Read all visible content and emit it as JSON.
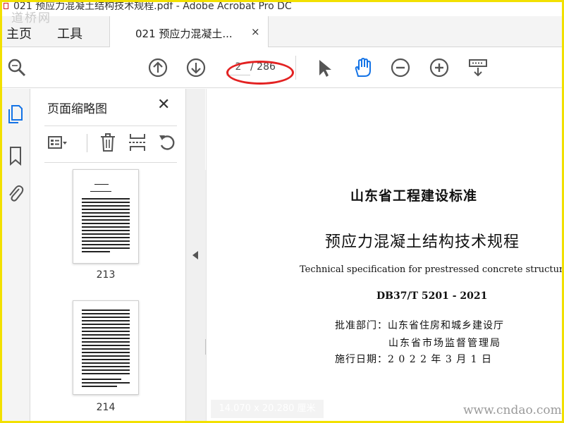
{
  "window": {
    "title": "021 预应力混凝土结构技术规程.pdf - Adobe Acrobat Pro DC",
    "watermark_top": "道桥网",
    "watermark_bottom": "www.cndao.com"
  },
  "nav": {
    "home": "主页",
    "tools": "工具"
  },
  "tab": {
    "label": "021 预应力混凝土...",
    "close": "×"
  },
  "toolbar": {
    "current_page": "2",
    "total_pages": "/ 286",
    "icons": [
      "zoom-search-icon",
      "previous-page-icon",
      "next-page-icon",
      "select-arrow-icon",
      "hand-tool-icon",
      "zoom-out-icon",
      "zoom-in-icon",
      "keyboard-icon"
    ]
  },
  "sidebar": {
    "icons": [
      "page-thumbnails-icon",
      "bookmark-icon",
      "attachment-icon"
    ]
  },
  "panel": {
    "title": "页面缩略图",
    "close": "✕",
    "thumbnails": [
      {
        "label": "213"
      },
      {
        "label": "214"
      }
    ]
  },
  "document": {
    "standard_title": "山东省工程建设标准",
    "title": "预应力混凝土结构技术规程",
    "title_en": "Technical specification for prestressed concrete structures",
    "code": "DB37/T 5201 - 2021",
    "approve_label": "批准部门：山东省住房和城乡建设厅",
    "approve_label_2": "山东省市场监督管理局",
    "date": "施行日期：2 0 2 2 年 3 月 1 日",
    "page_size": "14.070 x 20.280 厘米"
  },
  "colors": {
    "accent_blue": "#1473e6",
    "highlight_red": "#e32222",
    "frame_yellow": "#f2e000"
  }
}
